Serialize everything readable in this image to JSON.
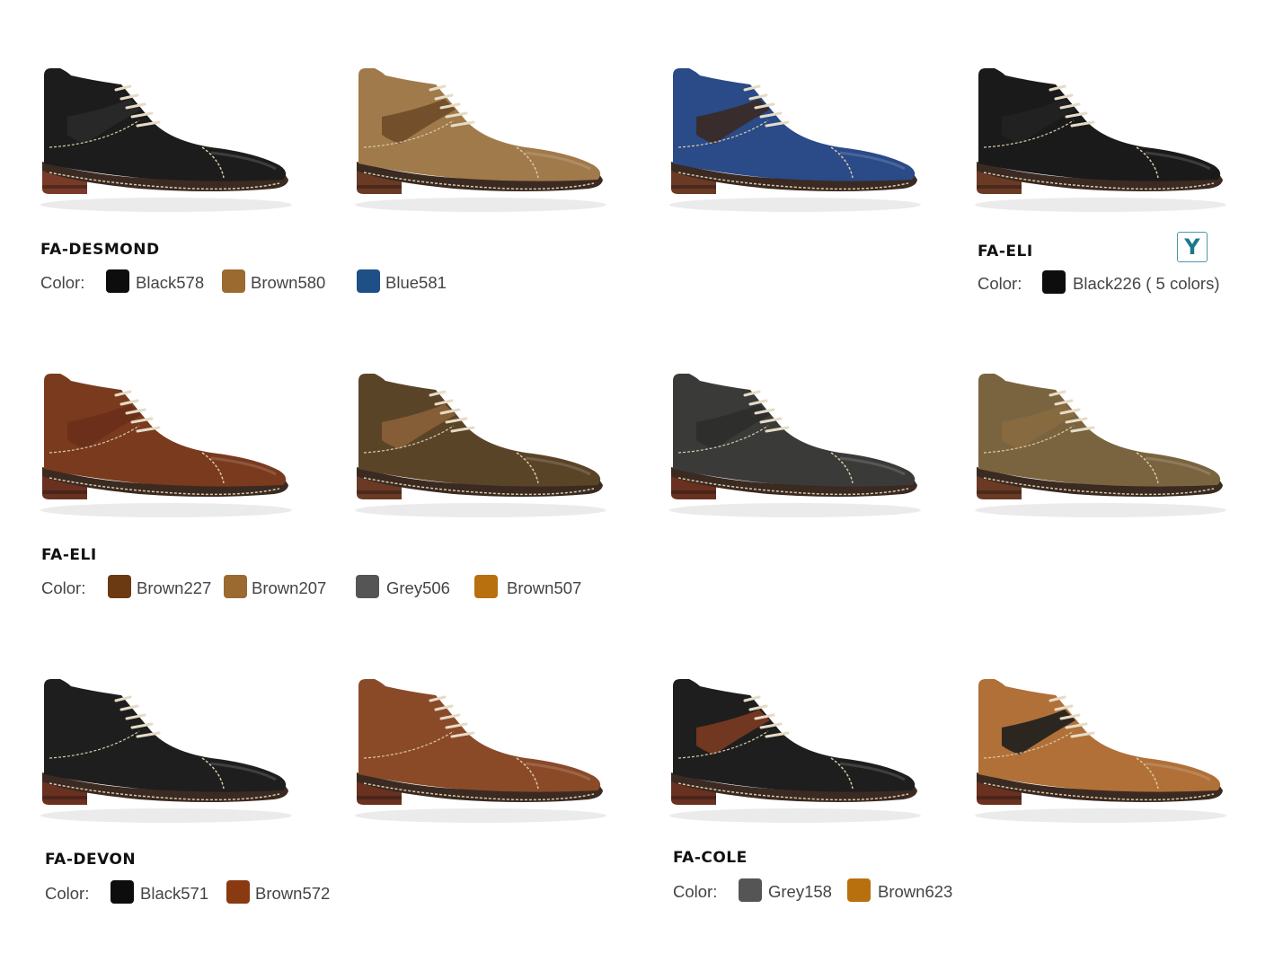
{
  "color_label": "Color:",
  "groups": [
    {
      "title": "FA-DESMOND",
      "swatches": [
        {
          "label": "Black578",
          "color": "#0d0d0d"
        },
        {
          "label": "Brown580",
          "color": "#9a6a30"
        },
        {
          "label": "Blue581",
          "color": "#1e4f86"
        }
      ]
    },
    {
      "title": "FA-ELI",
      "badge": "Y",
      "swatches": [
        {
          "label": "Black226 ( 5 colors)",
          "color": "#0d0d0d"
        }
      ]
    },
    {
      "title": "FA-ELI",
      "swatches": [
        {
          "label": "Brown227",
          "color": "#6b3a12"
        },
        {
          "label": "Brown207",
          "color": "#9a6a30"
        },
        {
          "label": "Grey506",
          "color": "#555555"
        },
        {
          "label": "Brown507",
          "color": "#b8700e"
        }
      ]
    },
    {
      "title": "FA-DEVON",
      "swatches": [
        {
          "label": "Black571",
          "color": "#0d0d0d"
        },
        {
          "label": "Brown572",
          "color": "#8a3a10"
        }
      ]
    },
    {
      "title": "FA-COLE",
      "swatches": [
        {
          "label": "Grey158",
          "color": "#555555"
        },
        {
          "label": "Brown623",
          "color": "#b8700e"
        }
      ]
    }
  ],
  "products": [
    {
      "upper": "#1c1c1c",
      "accent": "#2a2a2a",
      "sole": "#7a3a28"
    },
    {
      "upper": "#a07a4a",
      "accent": "#6e4a28",
      "sole": "#6a3a24"
    },
    {
      "upper": "#2a4a88",
      "accent": "#3a2a22",
      "sole": "#6a3a24"
    },
    {
      "upper": "#1a1a1a",
      "accent": "#222222",
      "sole": "#6a3a24"
    },
    {
      "upper": "#7a3a1e",
      "accent": "#6a301a",
      "sole": "#6a3020"
    },
    {
      "upper": "#5a4428",
      "accent": "#8a6038",
      "sole": "#6a3a24"
    },
    {
      "upper": "#3a3a38",
      "accent": "#2e2e2c",
      "sole": "#6a3020"
    },
    {
      "upper": "#7a6440",
      "accent": "#8a6a40",
      "sole": "#6a3a24"
    },
    {
      "upper": "#1e1e1e",
      "accent": "#1e1e1e",
      "sole": "#6a3020"
    },
    {
      "upper": "#8a4a28",
      "accent": "#8a4a28",
      "sole": "#6a3020"
    },
    {
      "upper": "#1e1e1e",
      "accent": "#7a3a20",
      "sole": "#6a3020"
    },
    {
      "upper": "#b07038",
      "accent": "#1e1e1e",
      "sole": "#6a3020"
    }
  ]
}
